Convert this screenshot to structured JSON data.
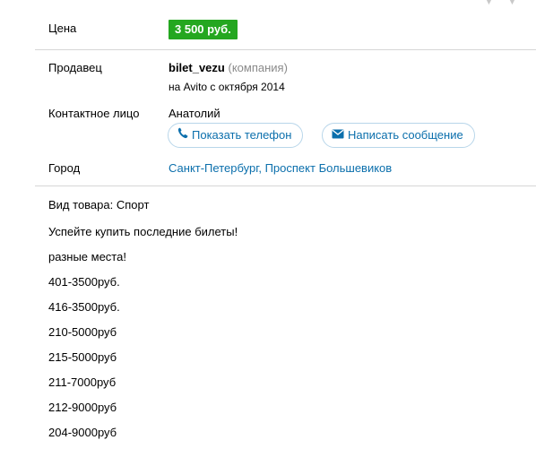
{
  "price": {
    "label": "Цена",
    "value": "3 500 руб."
  },
  "seller": {
    "label": "Продавец",
    "name": "bilet_vezu",
    "type": "(компания)",
    "since": "на Avito с октября 2014"
  },
  "contact": {
    "label": "Контактное лицо",
    "name": "Анатолий",
    "show_phone_label": "Показать телефон",
    "write_message_label": "Написать сообщение"
  },
  "city": {
    "label": "Город",
    "value": "Санкт-Петербург, Проспект Большевиков"
  },
  "description": {
    "category": "Вид товара: Спорт",
    "lines": [
      "Успейте купить последние билеты!",
      "разные места!",
      "401-3500руб.",
      "416-3500руб.",
      "210-5000руб",
      "215-5000руб",
      "211-7000руб",
      "212-9000руб",
      "204-9000руб"
    ]
  },
  "icons": {
    "top_partial": "partial-icon",
    "phone": "phone-icon",
    "envelope": "envelope-icon"
  },
  "colors": {
    "price_badge": "#24a720",
    "link": "#0b6fac",
    "button_border": "#b8d6ea"
  }
}
